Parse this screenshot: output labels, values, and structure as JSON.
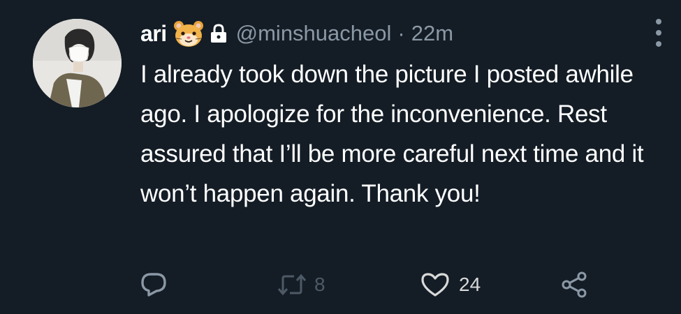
{
  "tweet": {
    "display_name": "ari",
    "handle": "@minshuacheol",
    "separator": "·",
    "timestamp": "22m",
    "text": "I already took down the picture I posted awhile ago. I apologize for the inconvenience. Rest assured that I’ll be more careful next time and it won’t happen again. Thank you!",
    "icons": {
      "name_emoji": "hamster-face-icon",
      "lock": "lock-icon",
      "more": "more-vertical-icon"
    }
  },
  "actions": {
    "reply": {
      "icon": "reply-icon",
      "count": ""
    },
    "retweet": {
      "icon": "retweet-icon",
      "count": "8"
    },
    "like": {
      "icon": "heart-icon",
      "count": "24"
    },
    "share": {
      "icon": "share-icon"
    }
  },
  "colors": {
    "background": "#141d26",
    "text_primary": "#ffffff",
    "text_secondary": "#8b98a5"
  }
}
